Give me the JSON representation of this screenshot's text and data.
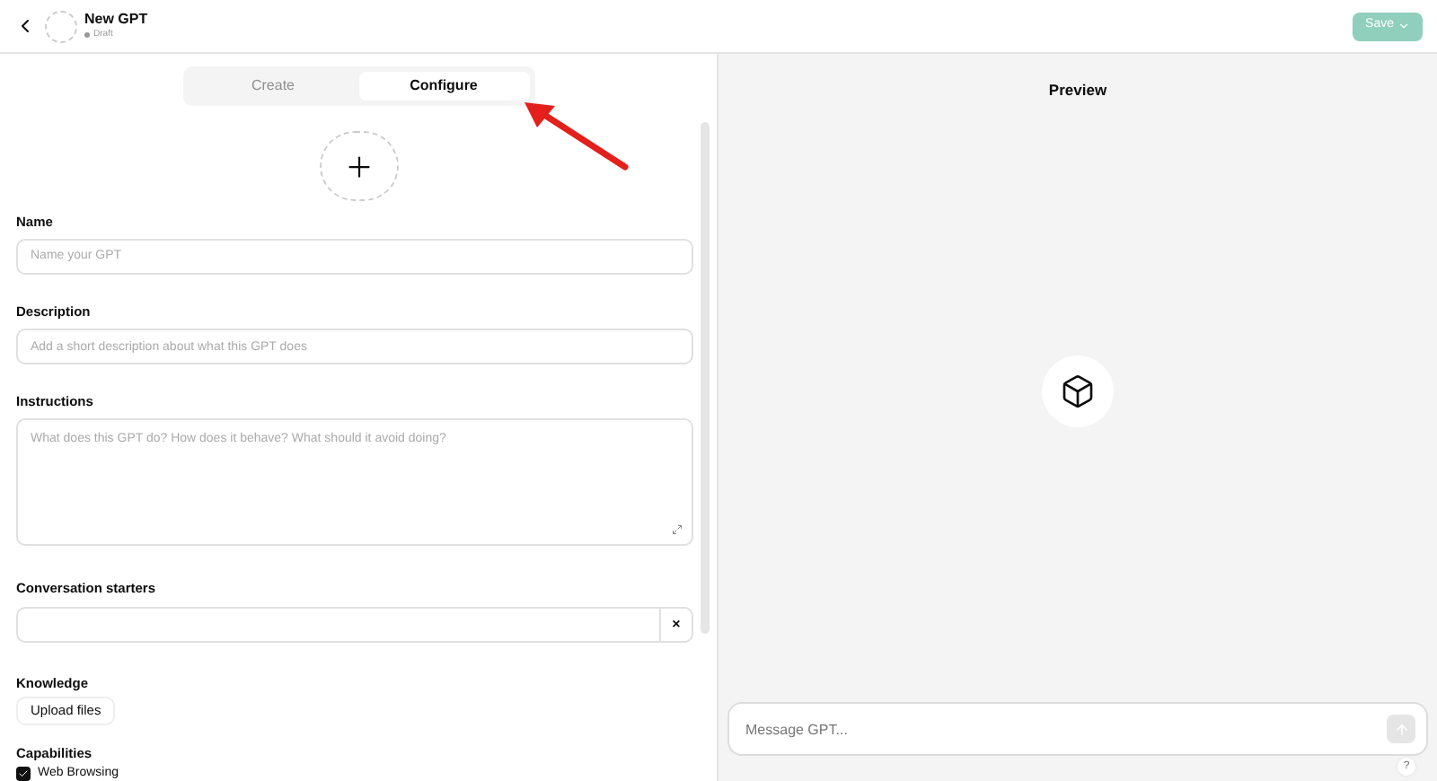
{
  "header": {
    "title": "New GPT",
    "status": "Draft",
    "save_button": "Save",
    "save_disabled": true
  },
  "tabs": [
    {
      "label": "Create",
      "selected": false
    },
    {
      "label": "Configure",
      "selected": true
    }
  ],
  "form": {
    "fields": [
      {
        "label": "Name",
        "placeholder": "Name your GPT",
        "kind": "input"
      },
      {
        "label": "Description",
        "placeholder": "Add a short description about what this GPT does",
        "kind": "input"
      },
      {
        "label": "Instructions",
        "placeholder": "What does this GPT do? How does it behave? What should it avoid doing?",
        "kind": "textarea"
      },
      {
        "label": "Conversation starters",
        "kind": "starter",
        "clear": "×"
      }
    ],
    "knowledge": {
      "label": "Knowledge",
      "button": "Upload files"
    },
    "capabilities": {
      "label": "Capabilities",
      "items": [
        {
          "label": "Web Browsing",
          "checked": true
        }
      ]
    }
  },
  "preview": {
    "title": "Preview",
    "message_placeholder": "Message GPT...",
    "help": "?"
  }
}
